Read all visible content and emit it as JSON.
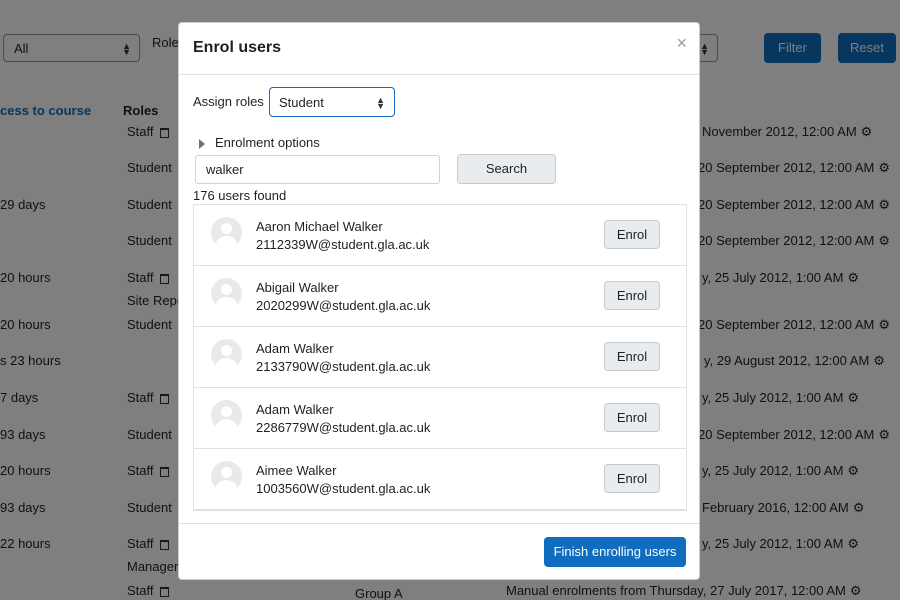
{
  "background": {
    "filter_select": "All",
    "roles_label": "Role",
    "filter_button": "Filter",
    "reset_button": "Reset",
    "col_access": "cess to course",
    "col_roles": "Roles",
    "access": [
      "",
      "",
      "29 days",
      "",
      "20 hours",
      "",
      "20 hours",
      "s 23 hours",
      "7 days",
      "93 days",
      "20 hours",
      "93 days",
      "22 hours",
      ""
    ],
    "roles": [
      "Staff",
      "Student",
      "Student",
      "Student",
      "Staff",
      "Site Repo",
      "Student",
      "",
      "Staff",
      "Student",
      "Staff",
      "Student",
      "Staff",
      "Manager",
      "Staff"
    ],
    "enrolments": [
      "November 2012, 12:00 AM",
      "20 September 2012, 12:00 AM",
      "20 September 2012, 12:00 AM",
      "20 September 2012, 12:00 AM",
      "y, 25 July 2012, 1:00 AM",
      "20 September 2012, 12:00 AM",
      "y, 29 August 2012, 12:00 AM",
      "y, 25 July 2012, 1:00 AM",
      "20 September 2012, 12:00 AM",
      "y, 25 July 2012, 1:00 AM",
      "February 2016, 12:00 AM",
      "y, 25 July 2012, 1:00 AM",
      "Manual enrolments from Thursday, 27 July 2017, 12:00 AM"
    ],
    "group": "Group A"
  },
  "modal": {
    "title": "Enrol users",
    "close": "×",
    "assign_roles_label": "Assign roles",
    "assign_roles_value": "Student",
    "enrolment_options": "Enrolment options",
    "search_value": "walker",
    "search_button": "Search",
    "users_found": "176 users found",
    "users": [
      {
        "name": "Aaron Michael Walker",
        "email": "2112339W@student.gla.ac.uk",
        "button": "Enrol"
      },
      {
        "name": "Abigail Walker",
        "email": "2020299W@student.gla.ac.uk",
        "button": "Enrol"
      },
      {
        "name": "Adam Walker",
        "email": "2133790W@student.gla.ac.uk",
        "button": "Enrol"
      },
      {
        "name": "Adam Walker",
        "email": "2286779W@student.gla.ac.uk",
        "button": "Enrol"
      },
      {
        "name": "Aimee Walker",
        "email": "1003560W@student.gla.ac.uk",
        "button": "Enrol"
      }
    ],
    "finish_button": "Finish enrolling users"
  },
  "colors": {
    "primary": "#0f6cbf",
    "overlay": "rgba(0,0,0,0.5)"
  }
}
